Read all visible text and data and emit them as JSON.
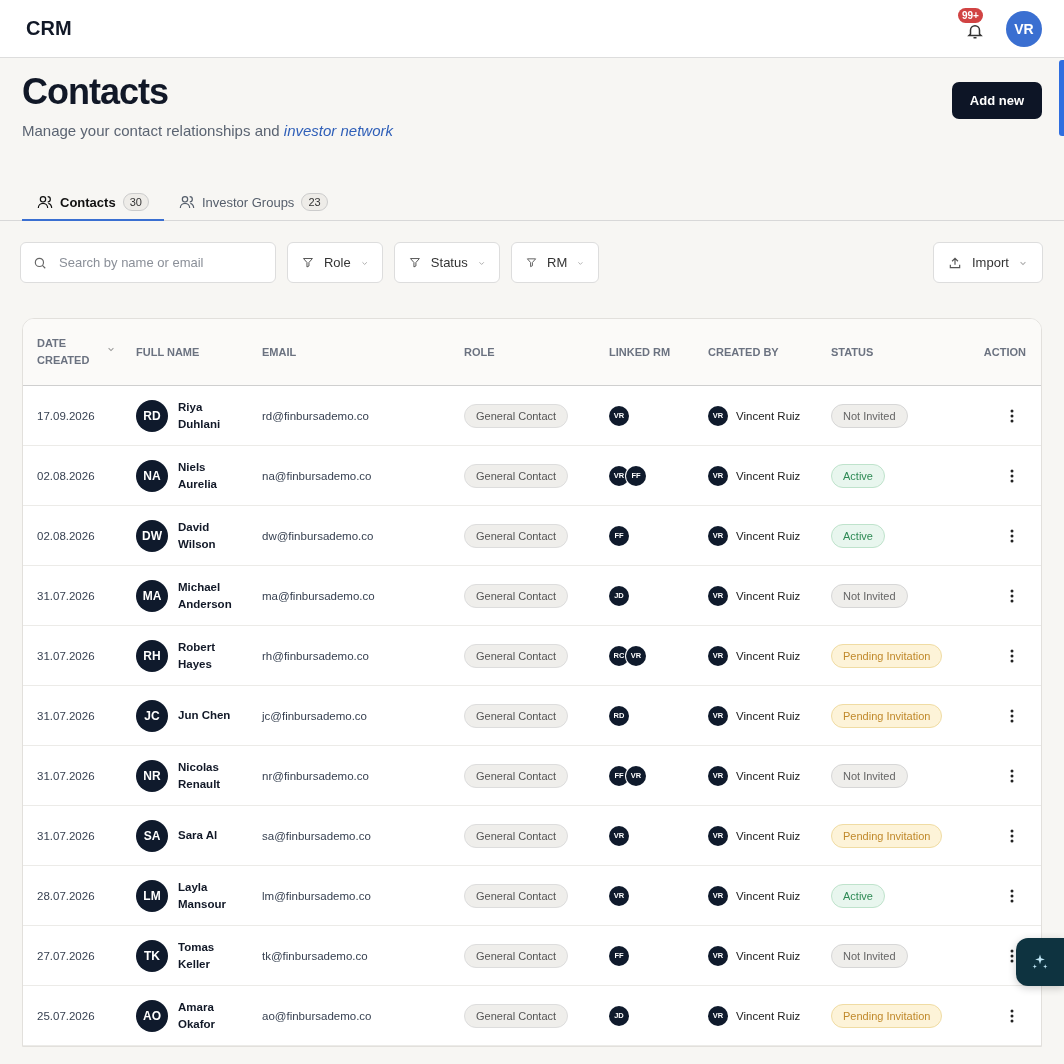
{
  "app": {
    "logo": "CRM",
    "notifications": "99+",
    "user_initials": "VR"
  },
  "page": {
    "title": "Contacts",
    "subtitle": "Manage your contact relationships and *investor network*",
    "add_button": "Add new"
  },
  "tabs": [
    {
      "label": "Contacts",
      "count": "30",
      "selected": true
    },
    {
      "label": "Investor Groups",
      "count": "23",
      "selected": false
    }
  ],
  "search": {
    "placeholder": "Search by name or email"
  },
  "filters": [
    "Role",
    "Status",
    "RM"
  ],
  "import_button": "Import",
  "table": {
    "columns": [
      "DATE CREATED",
      "FULL NAME",
      "EMAIL",
      "ROLE",
      "LINKED RM",
      "CREATED BY",
      "STATUS",
      "ACTION"
    ],
    "rows": [
      {
        "date": "17.09.2026",
        "initials": "RD",
        "name": "Riya Duhlani",
        "email": "rd@finbursademo.co",
        "role": "General Contact",
        "linked_rm": [
          "VR"
        ],
        "created_by_initials": "VR",
        "created_by": "Vincent Ruiz",
        "status": {
          "text": "Not Invited",
          "kind": "not_invited"
        }
      },
      {
        "date": "02.08.2026",
        "initials": "NA",
        "name": "Niels Aurelia",
        "email": "na@finbursademo.co",
        "role": "General Contact",
        "linked_rm": [
          "VR",
          "FF"
        ],
        "created_by_initials": "VR",
        "created_by": "Vincent Ruiz",
        "status": {
          "text": "Active",
          "kind": "active"
        }
      },
      {
        "date": "02.08.2026",
        "initials": "DW",
        "name": "David Wilson",
        "email": "dw@finbursademo.co",
        "role": "General Contact",
        "linked_rm": [
          "FF"
        ],
        "created_by_initials": "VR",
        "created_by": "Vincent Ruiz",
        "status": {
          "text": "Active",
          "kind": "active"
        }
      },
      {
        "date": "31.07.2026",
        "initials": "MA",
        "name": "Michael Anderson",
        "email": "ma@finbursademo.co",
        "role": "General Contact",
        "linked_rm": [
          "JD"
        ],
        "created_by_initials": "VR",
        "created_by": "Vincent Ruiz",
        "status": {
          "text": "Not Invited",
          "kind": "not_invited"
        }
      },
      {
        "date": "31.07.2026",
        "initials": "RH",
        "name": "Robert Hayes",
        "email": "rh@finbursademo.co",
        "role": "General Contact",
        "linked_rm": [
          "RC",
          "VR"
        ],
        "created_by_initials": "VR",
        "created_by": "Vincent Ruiz",
        "status": {
          "text": "Pending Invitation",
          "kind": "pending"
        }
      },
      {
        "date": "31.07.2026",
        "initials": "JC",
        "name": "Jun Chen",
        "email": "jc@finbursademo.co",
        "role": "General Contact",
        "linked_rm": [
          "RD"
        ],
        "created_by_initials": "VR",
        "created_by": "Vincent Ruiz",
        "status": {
          "text": "Pending Invitation",
          "kind": "pending"
        }
      },
      {
        "date": "31.07.2026",
        "initials": "NR",
        "name": "Nicolas Renault",
        "email": "nr@finbursademo.co",
        "role": "General Contact",
        "linked_rm": [
          "FF",
          "VR"
        ],
        "created_by_initials": "VR",
        "created_by": "Vincent Ruiz",
        "status": {
          "text": "Not Invited",
          "kind": "not_invited"
        }
      },
      {
        "date": "31.07.2026",
        "initials": "SA",
        "name": "Sara Al",
        "email": "sa@finbursademo.co",
        "role": "General Contact",
        "linked_rm": [
          "VR"
        ],
        "created_by_initials": "VR",
        "created_by": "Vincent Ruiz",
        "status": {
          "text": "Pending Invitation",
          "kind": "pending"
        }
      },
      {
        "date": "28.07.2026",
        "initials": "LM",
        "name": "Layla Mansour",
        "email": "lm@finbursademo.co",
        "role": "General Contact",
        "linked_rm": [
          "VR"
        ],
        "created_by_initials": "VR",
        "created_by": "Vincent Ruiz",
        "status": {
          "text": "Active",
          "kind": "active"
        }
      },
      {
        "date": "27.07.2026",
        "initials": "TK",
        "name": "Tomas Keller",
        "email": "tk@finbursademo.co",
        "role": "General Contact",
        "linked_rm": [
          "FF"
        ],
        "created_by_initials": "VR",
        "created_by": "Vincent Ruiz",
        "status": {
          "text": "Not Invited",
          "kind": "not_invited"
        }
      },
      {
        "date": "25.07.2026",
        "initials": "AO",
        "name": "Amara Okafor",
        "email": "ao@finbursademo.co",
        "role": "General Contact",
        "linked_rm": [
          "JD"
        ],
        "created_by_initials": "VR",
        "created_by": "Vincent Ruiz",
        "status": {
          "text": "Pending Invitation",
          "kind": "pending"
        }
      }
    ]
  }
}
